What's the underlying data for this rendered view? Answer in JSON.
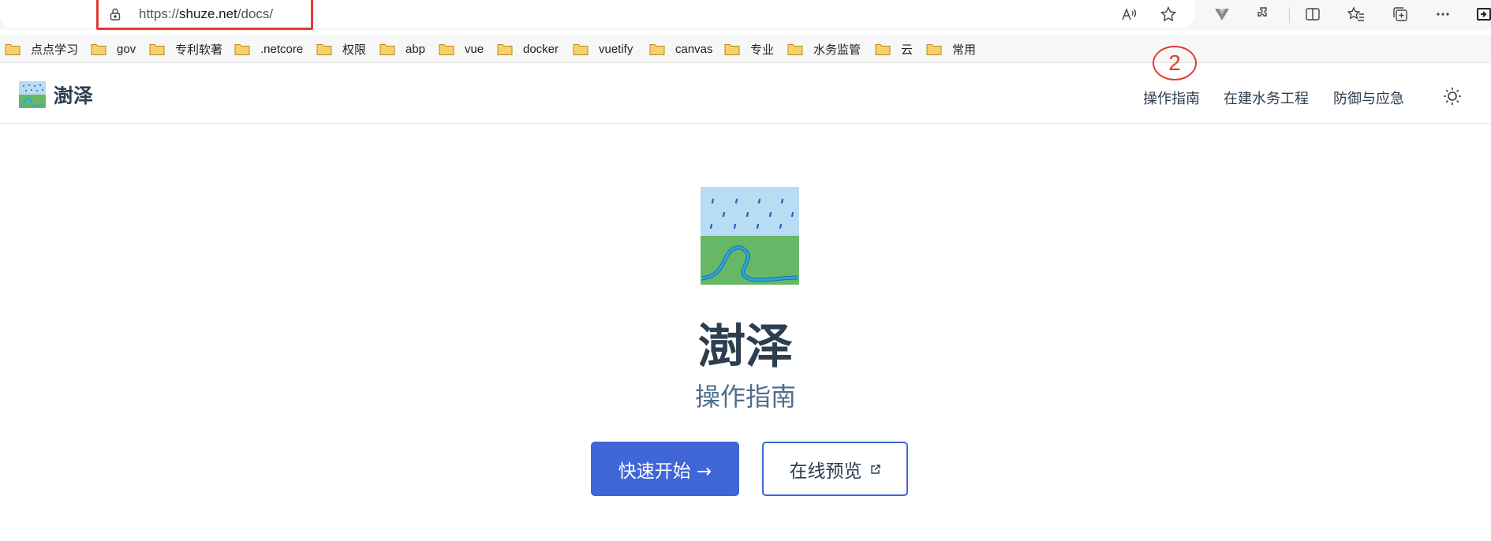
{
  "browser": {
    "url_prefix": "https://",
    "url_host": "shuze.net",
    "url_path": "/docs/",
    "bookmarks": [
      "点点学习",
      "gov",
      "专利软著",
      ".netcore",
      "权限",
      "abp",
      "vue",
      "docker",
      "vuetify",
      "canvas",
      "专业",
      "水务监管",
      "云",
      "常用"
    ]
  },
  "site": {
    "brand_name": "澍泽",
    "nav": [
      "操作指南",
      "在建水务工程",
      "防御与应急"
    ],
    "annotation_number": "2"
  },
  "hero": {
    "title": "澍泽",
    "tagline": "操作指南",
    "primary_label": "快速开始 →",
    "secondary_label": "在线预览"
  },
  "colors": {
    "accent": "#3f65d6",
    "text": "#2c3e50",
    "highlight": "#e53935",
    "logo_sky": "#b9dcf5",
    "logo_grass": "#66b866",
    "logo_river": "#2aa7df"
  }
}
